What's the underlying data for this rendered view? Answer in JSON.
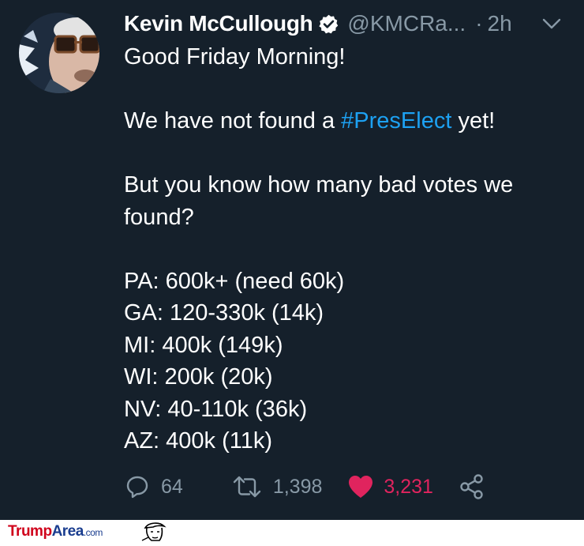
{
  "tweet": {
    "author_name": "Kevin McCullough",
    "handle": "@KMCRa...",
    "separator": "·",
    "time": "2h",
    "line1": "Good Friday Morning!",
    "line2_before": "We have not found a ",
    "line2_hashtag": "#PresElect",
    "line2_after": " yet!",
    "line3": "But you know how many bad votes we found?",
    "states": [
      "PA: 600k+ (need 60k)",
      "GA: 120-330k (14k)",
      "MI: 400k (149k)",
      "WI: 200k (20k)",
      "NV: 40-110k (36k)",
      "AZ: 400k (11k)"
    ],
    "reply_count": "64",
    "retweet_count": "1,398",
    "like_count": "3,231"
  },
  "watermark": {
    "part1": "Trump",
    "part2": "Area",
    "part3": ".com"
  },
  "colors": {
    "background": "#15202b",
    "hashtag": "#1da1f2",
    "like": "#e0245e",
    "muted": "#8899a6"
  },
  "icons": [
    "verified-badge-icon",
    "chevron-down-icon",
    "reply-icon",
    "retweet-icon",
    "heart-icon",
    "share-icon"
  ]
}
